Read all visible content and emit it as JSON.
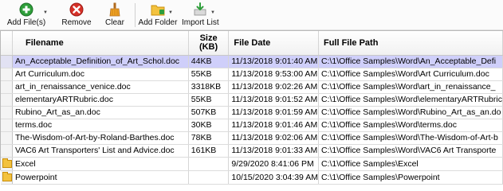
{
  "toolbar": {
    "add_files": "Add File(s)",
    "remove": "Remove",
    "clear": "Clear",
    "add_folder": "Add Folder",
    "import_list": "Import List"
  },
  "icons": {
    "add": "green-plus-circle-icon",
    "remove": "red-x-circle-icon",
    "clear": "broom-icon",
    "add_folder": "folder-icon",
    "import": "import-arrow-icon",
    "folder_row": "folder-icon"
  },
  "colors": {
    "selected_row": "#cfcffa",
    "add_green": "#2e9e3a",
    "remove_red": "#d63027",
    "folder_yellow": "#f3c23e"
  },
  "columns": {
    "filename": "Filename",
    "size_line1": "Size",
    "size_line2": "(KB)",
    "file_date": "File Date",
    "full_path": "Full File Path"
  },
  "rows": [
    {
      "name": "An_Acceptable_Definition_of_Art_Schol.doc",
      "size": "44KB",
      "date": "11/13/2018 9:01:40 AM",
      "path": "C:\\1\\Office Samples\\Word\\An_Acceptable_Defi",
      "selected": true,
      "folder": false
    },
    {
      "name": "Art Curriculum.doc",
      "size": "55KB",
      "date": "11/13/2018 9:53:00 AM",
      "path": "C:\\1\\Office Samples\\Word\\Art Curriculum.doc",
      "selected": false,
      "folder": false
    },
    {
      "name": "art_in_renaissance_venice.doc",
      "size": "3318KB",
      "date": "11/13/2018 9:02:26 AM",
      "path": "C:\\1\\Office Samples\\Word\\art_in_renaissance_",
      "selected": false,
      "folder": false
    },
    {
      "name": "elementaryARTRubric.doc",
      "size": "55KB",
      "date": "11/13/2018 9:01:52 AM",
      "path": "C:\\1\\Office Samples\\Word\\elementaryARTRubric",
      "selected": false,
      "folder": false
    },
    {
      "name": "Rubino_Art_as_an.doc",
      "size": "507KB",
      "date": "11/13/2018 9:01:59 AM",
      "path": "C:\\1\\Office Samples\\Word\\Rubino_Art_as_an.do",
      "selected": false,
      "folder": false
    },
    {
      "name": "terms.doc",
      "size": "30KB",
      "date": "11/13/2018 9:01:46 AM",
      "path": "C:\\1\\Office Samples\\Word\\terms.doc",
      "selected": false,
      "folder": false
    },
    {
      "name": "The-Wisdom-of-Art-by-Roland-Barthes.doc",
      "size": "78KB",
      "date": "11/13/2018 9:02:06 AM",
      "path": "C:\\1\\Office Samples\\Word\\The-Wisdom-of-Art-b",
      "selected": false,
      "folder": false
    },
    {
      "name": "VAC6 Art Transporters' List and Advice.doc",
      "size": "161KB",
      "date": "11/13/2018 9:01:33 AM",
      "path": "C:\\1\\Office Samples\\Word\\VAC6 Art Transporte",
      "selected": false,
      "folder": false
    },
    {
      "name": "Excel",
      "size": "",
      "date": "9/29/2020 8:41:06 PM",
      "path": "C:\\1\\Office Samples\\Excel",
      "selected": false,
      "folder": true
    },
    {
      "name": "Powerpoint",
      "size": "",
      "date": "10/15/2020 3:04:39 AM",
      "path": "C:\\1\\Office Samples\\Powerpoint",
      "selected": false,
      "folder": true
    }
  ]
}
